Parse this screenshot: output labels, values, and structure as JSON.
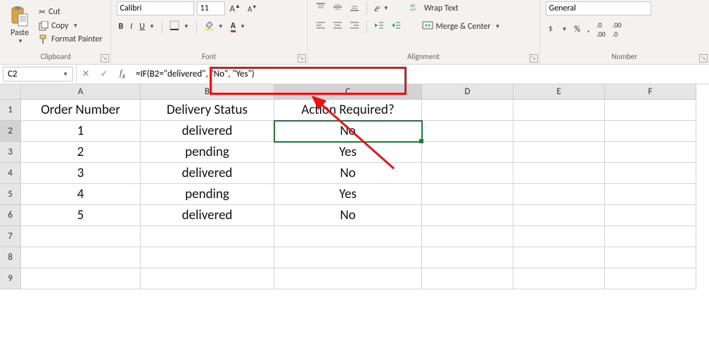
{
  "ribbon": {
    "clipboard": {
      "label": "Clipboard",
      "paste": "Paste",
      "cut": "Cut",
      "copy": "Copy",
      "format_painter": "Format Painter"
    },
    "font": {
      "label": "Font",
      "name": "Calibri",
      "size": "11"
    },
    "alignment": {
      "label": "Alignment",
      "wrap": "Wrap Text",
      "merge": "Merge & Center"
    },
    "number": {
      "label": "Number",
      "format": "General"
    }
  },
  "name_box": "C2",
  "formula": "=IF(B2=\"delivered\", \"No\", \"Yes\")",
  "columns": [
    "A",
    "B",
    "C",
    "D",
    "E",
    "F"
  ],
  "col_widths": [
    "wA",
    "wB",
    "wC",
    "wD",
    "wE",
    "wF"
  ],
  "rows": [
    {
      "n": "1",
      "cells": [
        "Order Number",
        "Delivery Status",
        "Action Required?",
        "",
        "",
        ""
      ]
    },
    {
      "n": "2",
      "cells": [
        "1",
        "delivered",
        "No",
        "",
        "",
        ""
      ]
    },
    {
      "n": "3",
      "cells": [
        "2",
        "pending",
        "Yes",
        "",
        "",
        ""
      ]
    },
    {
      "n": "4",
      "cells": [
        "3",
        "delivered",
        "No",
        "",
        "",
        ""
      ]
    },
    {
      "n": "5",
      "cells": [
        "4",
        "pending",
        "Yes",
        "",
        "",
        ""
      ]
    },
    {
      "n": "6",
      "cells": [
        "5",
        "delivered",
        "No",
        "",
        "",
        ""
      ]
    },
    {
      "n": "7",
      "cells": [
        "",
        "",
        "",
        "",
        "",
        ""
      ]
    },
    {
      "n": "8",
      "cells": [
        "",
        "",
        "",
        "",
        "",
        ""
      ]
    },
    {
      "n": "9",
      "cells": [
        "",
        "",
        "",
        "",
        "",
        ""
      ]
    }
  ],
  "active": {
    "row": "2",
    "col": "C"
  }
}
